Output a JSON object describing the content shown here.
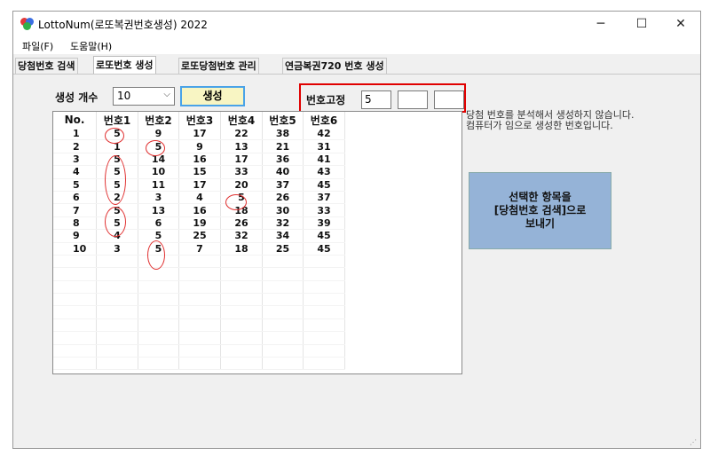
{
  "window": {
    "title": "LottoNum(로또복권번호생성) 2022",
    "minimize_icon": "─",
    "maximize_icon": "☐",
    "close_icon": "✕"
  },
  "menu": [
    "파일(F)",
    "도움말(H)"
  ],
  "tabs": [
    {
      "label": "당첨번호 검색",
      "active": false
    },
    {
      "label": "로또번호 생성",
      "active": true
    },
    {
      "label": "로또당첨번호 관리",
      "active": false
    },
    {
      "label": "연금복권720 번호 생성",
      "active": false
    }
  ],
  "controls": {
    "count_label": "생성 개수",
    "count_value": "10",
    "generate_label": "생성",
    "fix_label": "번호고정",
    "fix_values": [
      "5",
      "",
      ""
    ]
  },
  "table": {
    "headers": [
      "No.",
      "번호1",
      "번호2",
      "번호3",
      "번호4",
      "번호5",
      "번호6"
    ],
    "rows": [
      [
        "1",
        "5",
        "9",
        "17",
        "22",
        "38",
        "42"
      ],
      [
        "2",
        "1",
        "5",
        "9",
        "13",
        "21",
        "31"
      ],
      [
        "3",
        "5",
        "14",
        "16",
        "17",
        "36",
        "41"
      ],
      [
        "4",
        "5",
        "10",
        "15",
        "33",
        "40",
        "43"
      ],
      [
        "5",
        "5",
        "11",
        "17",
        "20",
        "37",
        "45"
      ],
      [
        "6",
        "2",
        "3",
        "4",
        "5",
        "26",
        "37"
      ],
      [
        "7",
        "5",
        "13",
        "16",
        "18",
        "30",
        "33"
      ],
      [
        "8",
        "5",
        "6",
        "19",
        "26",
        "32",
        "39"
      ],
      [
        "9",
        "4",
        "5",
        "25",
        "32",
        "34",
        "45"
      ],
      [
        "10",
        "3",
        "5",
        "7",
        "18",
        "25",
        "45"
      ]
    ]
  },
  "info_text": [
    "당첨 번호를 분석해서 생성하지 않습니다.",
    "컴퓨터가 임으로 생성한 번호입니다."
  ],
  "send_button": [
    "선택한 항목을",
    "[당첨번호 검색]으로",
    "보내기"
  ],
  "colors": {
    "accent_red": "#e00000",
    "send_button_bg": "#95b3d7",
    "generate_button_bg": "#f8f5c3"
  }
}
